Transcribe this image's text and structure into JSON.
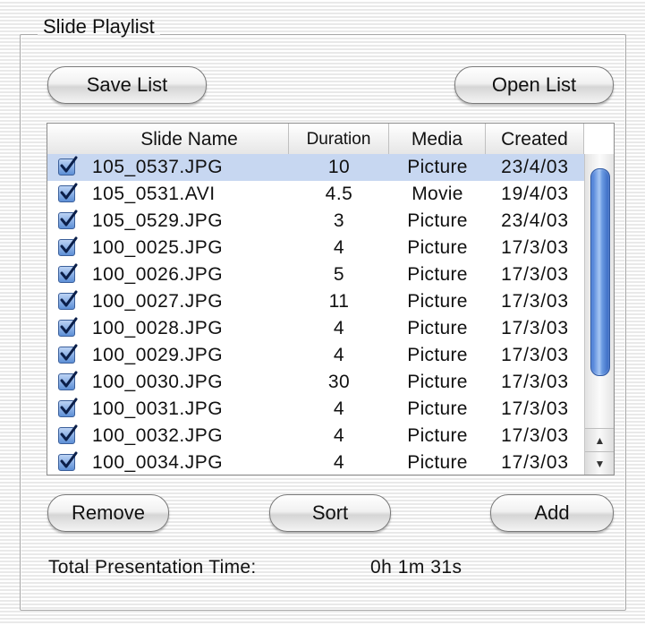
{
  "window": {
    "group_title": "Slide Playlist"
  },
  "toolbar": {
    "save_label": "Save List",
    "open_label": "Open List"
  },
  "table": {
    "columns": [
      "Slide Name",
      "Duration",
      "Media",
      "Created"
    ],
    "rows": [
      {
        "checked": true,
        "name": "105_0537.JPG",
        "duration": "10",
        "media": "Picture",
        "created": "23/4/03",
        "selected": true
      },
      {
        "checked": true,
        "name": "105_0531.AVI",
        "duration": "4.5",
        "media": "Movie",
        "created": "19/4/03"
      },
      {
        "checked": true,
        "name": "105_0529.JPG",
        "duration": "3",
        "media": "Picture",
        "created": "23/4/03"
      },
      {
        "checked": true,
        "name": "100_0025.JPG",
        "duration": "4",
        "media": "Picture",
        "created": "17/3/03"
      },
      {
        "checked": true,
        "name": "100_0026.JPG",
        "duration": "5",
        "media": "Picture",
        "created": "17/3/03"
      },
      {
        "checked": true,
        "name": "100_0027.JPG",
        "duration": "11",
        "media": "Picture",
        "created": "17/3/03"
      },
      {
        "checked": true,
        "name": "100_0028.JPG",
        "duration": "4",
        "media": "Picture",
        "created": "17/3/03"
      },
      {
        "checked": true,
        "name": "100_0029.JPG",
        "duration": "4",
        "media": "Picture",
        "created": "17/3/03"
      },
      {
        "checked": true,
        "name": "100_0030.JPG",
        "duration": "30",
        "media": "Picture",
        "created": "17/3/03"
      },
      {
        "checked": true,
        "name": "100_0031.JPG",
        "duration": "4",
        "media": "Picture",
        "created": "17/3/03"
      },
      {
        "checked": true,
        "name": "100_0032.JPG",
        "duration": "4",
        "media": "Picture",
        "created": "17/3/03"
      },
      {
        "checked": true,
        "name": "100_0034.JPG",
        "duration": "4",
        "media": "Picture",
        "created": "17/3/03"
      }
    ]
  },
  "scrollbar": {
    "up_icon": "▲",
    "down_icon": "▼"
  },
  "actions": {
    "remove_label": "Remove",
    "sort_label": "Sort",
    "add_label": "Add"
  },
  "summary": {
    "total_label": "Total Presentation Time:",
    "total_value": "0h 1m 31s"
  },
  "colors": {
    "selection": "#c7d7f1",
    "accent": "#3e74d2"
  }
}
